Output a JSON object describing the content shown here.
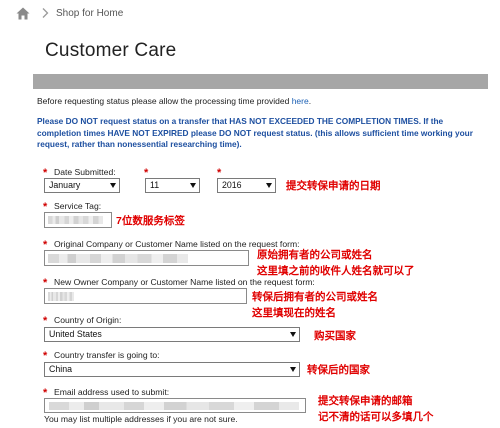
{
  "breadcrumb": {
    "home_icon": "home-icon",
    "separator_icon": "chevron-right-icon",
    "link": "Shop for Home"
  },
  "page": {
    "title": "Customer Care"
  },
  "intro": {
    "text": "Before requesting status please allow the processing time provided ",
    "link": "here",
    "end": "."
  },
  "notice": "Please DO NOT request status on a transfer that HAS NOT EXCEEDED THE COMPLETION TIMES. If the completion times HAVE NOT EXPIRED please DO NOT request status. (this allows sufficient time working your request, rather than nonessential researching time).",
  "form": {
    "required_mark": "*",
    "date": {
      "label": "Date Submitted:",
      "month": "January",
      "day": "11",
      "year": "2016"
    },
    "service_tag": {
      "label": "Service Tag:"
    },
    "original_owner": {
      "label": "Original Company or Customer Name listed on the request form:"
    },
    "new_owner": {
      "label": "New Owner Company or Customer Name listed on the request form:"
    },
    "origin": {
      "label": "Country of Origin:",
      "value": "United States"
    },
    "destination": {
      "label": "Country transfer is going to:",
      "value": "China"
    },
    "email": {
      "label": "Email address used to submit:",
      "hint": "You may list multiple addresses if you are not sure."
    }
  },
  "annotations": {
    "date": "提交转保申请的日期",
    "service_tag": "7位数服务标签",
    "original_1": "原始拥有者的公司或姓名",
    "original_2": "这里填之前的收件人姓名就可以了",
    "new_1": "转保后拥有者的公司或姓名",
    "new_2": "这里填现在的姓名",
    "origin": "购买国家",
    "destination": "转保后的国家",
    "email_1": "提交转保申请的邮箱",
    "email_2": "记不清的话可以多填几个"
  },
  "colors": {
    "notice": "#1d4fa0",
    "required": "#d00000",
    "annotation": "#e00000",
    "bar": "#a6a6a6"
  }
}
